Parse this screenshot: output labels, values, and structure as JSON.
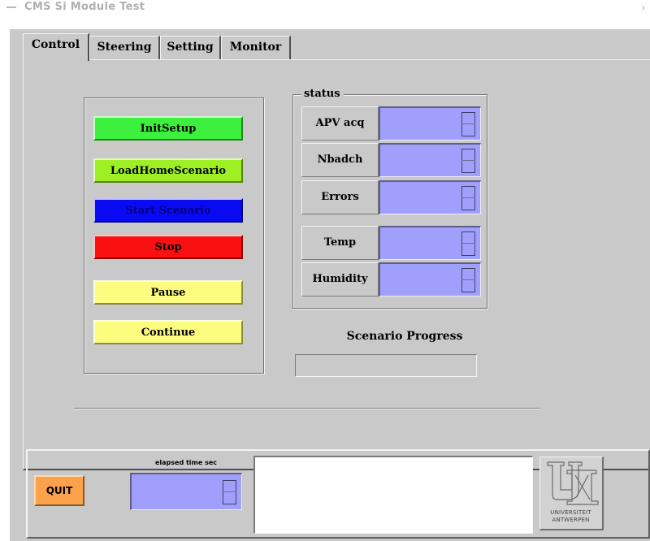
{
  "window": {
    "title": "CMS  Si Module Test"
  },
  "tabs": [
    {
      "label": "Control",
      "active": true
    },
    {
      "label": "Steering",
      "active": false
    },
    {
      "label": "Setting",
      "active": false
    },
    {
      "label": "Monitor",
      "active": false
    }
  ],
  "controls": {
    "init_setup": {
      "label": "InitSetup",
      "color": "#3ef03e"
    },
    "load_home_scenario": {
      "label": "LoadHomeScenario",
      "color": "#9ef024"
    },
    "start_scenario": {
      "label": "Start Scenario",
      "color": "#0a0af2"
    },
    "stop": {
      "label": "Stop",
      "color": "#fa1010"
    },
    "pause": {
      "label": "Pause",
      "color": "#fcfc7e"
    },
    "continue": {
      "label": "Continue",
      "color": "#fcfc7e"
    }
  },
  "status": {
    "legend": "status",
    "apv_acq": {
      "label": "APV acq",
      "value": "0"
    },
    "nbadch": {
      "label": "Nbadch",
      "value": "0"
    },
    "errors": {
      "label": "Errors",
      "value": "0"
    },
    "temp": {
      "label": "Temp",
      "value": "0"
    },
    "humidity": {
      "label": "Humidity",
      "value": "0"
    },
    "lcd_color": "#a0a0fc"
  },
  "progress": {
    "label": "Scenario Progress",
    "value": 0
  },
  "bottom": {
    "quit_label": "QUIT",
    "quit_color": "#fca24c",
    "elapsed_label": "elapsed time sec",
    "elapsed_value": "0",
    "message": ""
  },
  "logo": {
    "line1": "UNIVERSITEIT",
    "line2": "ANTWERPEN"
  }
}
